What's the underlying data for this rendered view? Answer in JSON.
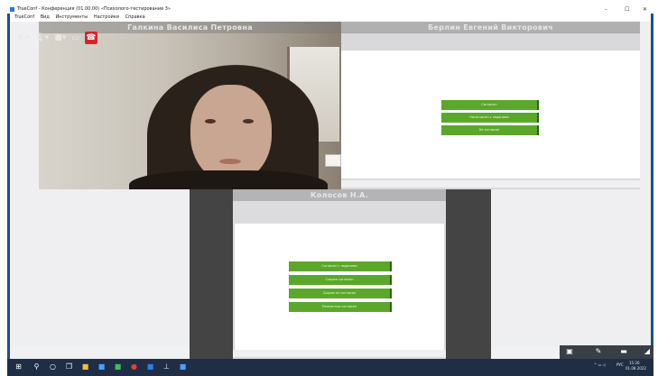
{
  "window": {
    "title": "TrueConf - Конференция (01.00.00) «Психолого-тестирование 3»",
    "controls": {
      "minimize": "–",
      "maximize": "☐",
      "close": "✕"
    }
  },
  "menu": {
    "items": [
      "TrueConf",
      "Вид",
      "Инструменты",
      "Настройки",
      "Справка"
    ]
  },
  "toolbar": {
    "icons": [
      "speaker-icon",
      "microphone-icon",
      "camera-icon",
      "share-screen-icon",
      "hangup-icon"
    ]
  },
  "tiles": {
    "video_main": {
      "name": "Галкина Василиса Петровна"
    },
    "share_top_right": {
      "name": "Берлин Евгений Викторович",
      "buttons": [
        "Согласен",
        "Несогласен с заданием",
        "Не согласен"
      ]
    },
    "share_bottom_center": {
      "name": "Колосов Н.А.",
      "buttons": [
        "Согласен с заданием",
        "Скорее согласен",
        "Скорее не согласен",
        "Полностью согласен"
      ]
    }
  },
  "taskbar": {
    "tray_time": "15:20",
    "tray_date": "01.08.2022",
    "tray_lang": "РУС"
  },
  "colors": {
    "frame": "#1a4f93",
    "green_button": "#5ba72b",
    "taskbar": "#1f2e44",
    "hangup": "#d8242a"
  }
}
